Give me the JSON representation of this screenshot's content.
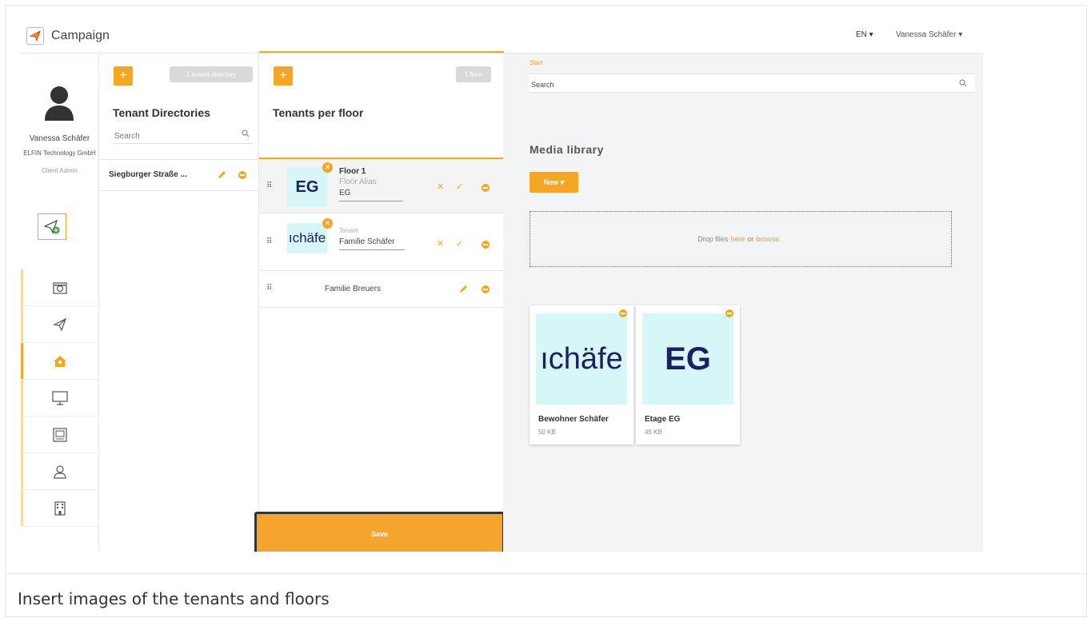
{
  "app": {
    "title": "Campaign",
    "language": "EN ▾",
    "user_menu": "Vanessa Schäfer ▾"
  },
  "profile": {
    "name": "Vanessa Schäfer",
    "company": "ELFIN Technology GmbH",
    "role": "Client Admin"
  },
  "nav": {
    "items": [
      {
        "icon": "camera-icon",
        "active": false
      },
      {
        "icon": "paper-plane-icon",
        "active": false
      },
      {
        "icon": "house-icon",
        "active": true
      },
      {
        "icon": "monitor-icon",
        "active": false
      },
      {
        "icon": "layout-icon",
        "active": false
      },
      {
        "icon": "user-icon",
        "active": false
      },
      {
        "icon": "building-icon",
        "active": false
      }
    ]
  },
  "directories": {
    "add_label": "+",
    "count_badge": "1 tenant directory",
    "heading": "Tenant Directories",
    "search_placeholder": "Search",
    "items": [
      {
        "name": "Siegburger Straße ..."
      }
    ]
  },
  "floors": {
    "add_label": "+",
    "count_badge": "1 floor",
    "heading": "Tenants per floor",
    "rows": [
      {
        "thumb_text": "EG",
        "title": "Floor 1",
        "field_label": "Floor Alias",
        "field_value": "EG"
      },
      {
        "thumb_text": "ıchäfe",
        "field_label": "Tenant",
        "field_value": "Familie Schäfer"
      },
      {
        "name": "Familie Breuers"
      }
    ],
    "save_label": "Save"
  },
  "media": {
    "breadcrumb": "Start",
    "search_placeholder": "Search",
    "title": "Media library",
    "new_label": "New ▾",
    "drop_prefix": "Drop files",
    "drop_here": "here",
    "drop_or": "or",
    "drop_browse": "browse.",
    "cards": [
      {
        "image_text": "ıchäfe",
        "name": "Bewohner Schäfer",
        "size": "50 KB"
      },
      {
        "image_text": "EG",
        "name": "Etage EG",
        "size": "45 KB"
      }
    ]
  },
  "caption": "Insert images of the tenants and floors",
  "colors": {
    "accent": "#f5a623",
    "thumb_bg": "#d6f6f8",
    "thumb_text": "#1a2060"
  }
}
